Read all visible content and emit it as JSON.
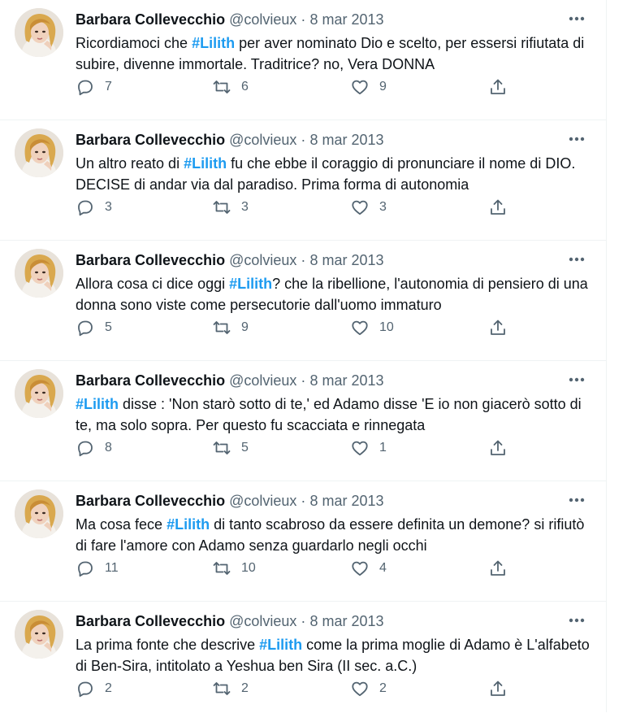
{
  "tweets": [
    {
      "name": "Barbara Collevecchio",
      "handle": "@colvieux",
      "separator": "·",
      "date": "8 mar 2013",
      "text_before": "Ricordiamoci che ",
      "hashtag": "#Lilith",
      "text_after": " per aver nominato Dio e scelto, per essersi rifiutata di subire, divenne immortale. Traditrice? no, Vera DONNA",
      "replies": "7",
      "retweets": "6",
      "likes": "9"
    },
    {
      "name": "Barbara Collevecchio",
      "handle": "@colvieux",
      "separator": "·",
      "date": "8 mar 2013",
      "text_before": "Un altro reato di ",
      "hashtag": "#Lilith",
      "text_after": " fu che ebbe il coraggio di pronunciare il nome di DIO. DECISE di andar via dal paradiso. Prima forma di autonomia",
      "replies": "3",
      "retweets": "3",
      "likes": "3"
    },
    {
      "name": "Barbara Collevecchio",
      "handle": "@colvieux",
      "separator": "·",
      "date": "8 mar 2013",
      "text_before": "Allora cosa ci dice oggi ",
      "hashtag": "#Lilith",
      "text_after": "? che la ribellione, l'autonomia di pensiero di una donna sono viste come persecutorie dall'uomo immaturo",
      "replies": "5",
      "retweets": "9",
      "likes": "10"
    },
    {
      "name": "Barbara Collevecchio",
      "handle": "@colvieux",
      "separator": "·",
      "date": "8 mar 2013",
      "text_before": "",
      "hashtag": "#Lilith",
      "text_after": " disse :  'Non starò sotto di te,' ed Adamo disse 'E io non giacerò sotto di te, ma solo sopra. Per questo fu  scacciata e rinnegata",
      "replies": "8",
      "retweets": "5",
      "likes": "1"
    },
    {
      "name": "Barbara Collevecchio",
      "handle": "@colvieux",
      "separator": "·",
      "date": "8 mar 2013",
      "text_before": "Ma cosa fece ",
      "hashtag": "#Lilith",
      "text_after": " di tanto scabroso da essere definita un demone? si rifiutò di fare l'amore con Adamo senza guardarlo negli occhi",
      "replies": "11",
      "retweets": "10",
      "likes": "4"
    },
    {
      "name": "Barbara Collevecchio",
      "handle": "@colvieux",
      "separator": "·",
      "date": "8 mar 2013",
      "text_before": "La prima fonte che descrive ",
      "hashtag": "#Lilith",
      "text_after": " come la prima moglie di Adamo è L'alfabeto di Ben-Sira, intitolato a Yeshua ben Sira (II sec. a.C.)",
      "replies": "2",
      "retweets": "2",
      "likes": "2"
    }
  ],
  "icons": {
    "more": "more-horizontal-icon",
    "reply": "reply-icon",
    "retweet": "retweet-icon",
    "like": "heart-icon",
    "share": "share-icon"
  },
  "colors": {
    "hashtag": "#1d9bf0",
    "secondary_text": "#536471",
    "divider": "#eff3f4"
  }
}
